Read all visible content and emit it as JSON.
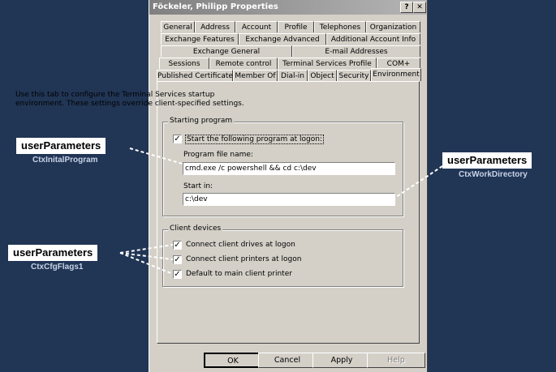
{
  "window": {
    "title": "Föckeler, Philipp Properties",
    "help_glyph": "?",
    "close_glyph": "✕"
  },
  "tabs": {
    "row1": [
      "General",
      "Address",
      "Account",
      "Profile",
      "Telephones",
      "Organization"
    ],
    "row2": [
      "Exchange Features",
      "Exchange Advanced",
      "Additional Account Info"
    ],
    "row3": [
      "Exchange General",
      "E-mail Addresses"
    ],
    "row4": [
      "Sessions",
      "Remote control",
      "Terminal Services Profile",
      "COM+"
    ],
    "row5": [
      "Published Certificates",
      "Member Of",
      "Dial-in",
      "Object",
      "Security",
      "Environment"
    ],
    "active": "Environment"
  },
  "info_text": "Use this tab to configure the Terminal Services startup environment. These settings override client-specified settings.",
  "starting_program": {
    "group_label": "Starting program",
    "checkbox_label": "Start the following program at logon:",
    "checked": true,
    "program_label": "Program file name:",
    "program_value": "cmd.exe /c powershell && cd c:\\dev",
    "startin_label": "Start in:",
    "startin_value": "c:\\dev"
  },
  "client_devices": {
    "group_label": "Client devices",
    "items": [
      {
        "label": "Connect client drives at logon",
        "checked": true
      },
      {
        "label": "Connect client printers at logon",
        "checked": true
      },
      {
        "label": "Default to main client printer",
        "checked": true
      }
    ]
  },
  "buttons": {
    "ok": "OK",
    "cancel": "Cancel",
    "apply": "Apply",
    "help": "Help"
  },
  "check_glyph": "✓",
  "annotations": {
    "left_top": {
      "title": "userParameters",
      "sub": "CtxInitalProgram"
    },
    "left_bottom": {
      "title": "userParameters",
      "sub": "CtxCfgFlags1"
    },
    "right": {
      "title": "userParameters",
      "sub": "CtxWorkDirectory"
    }
  },
  "colors": {
    "background": "#213555",
    "dialog": "#d4d0c8",
    "annotation_sub": "#c7d3e6"
  }
}
